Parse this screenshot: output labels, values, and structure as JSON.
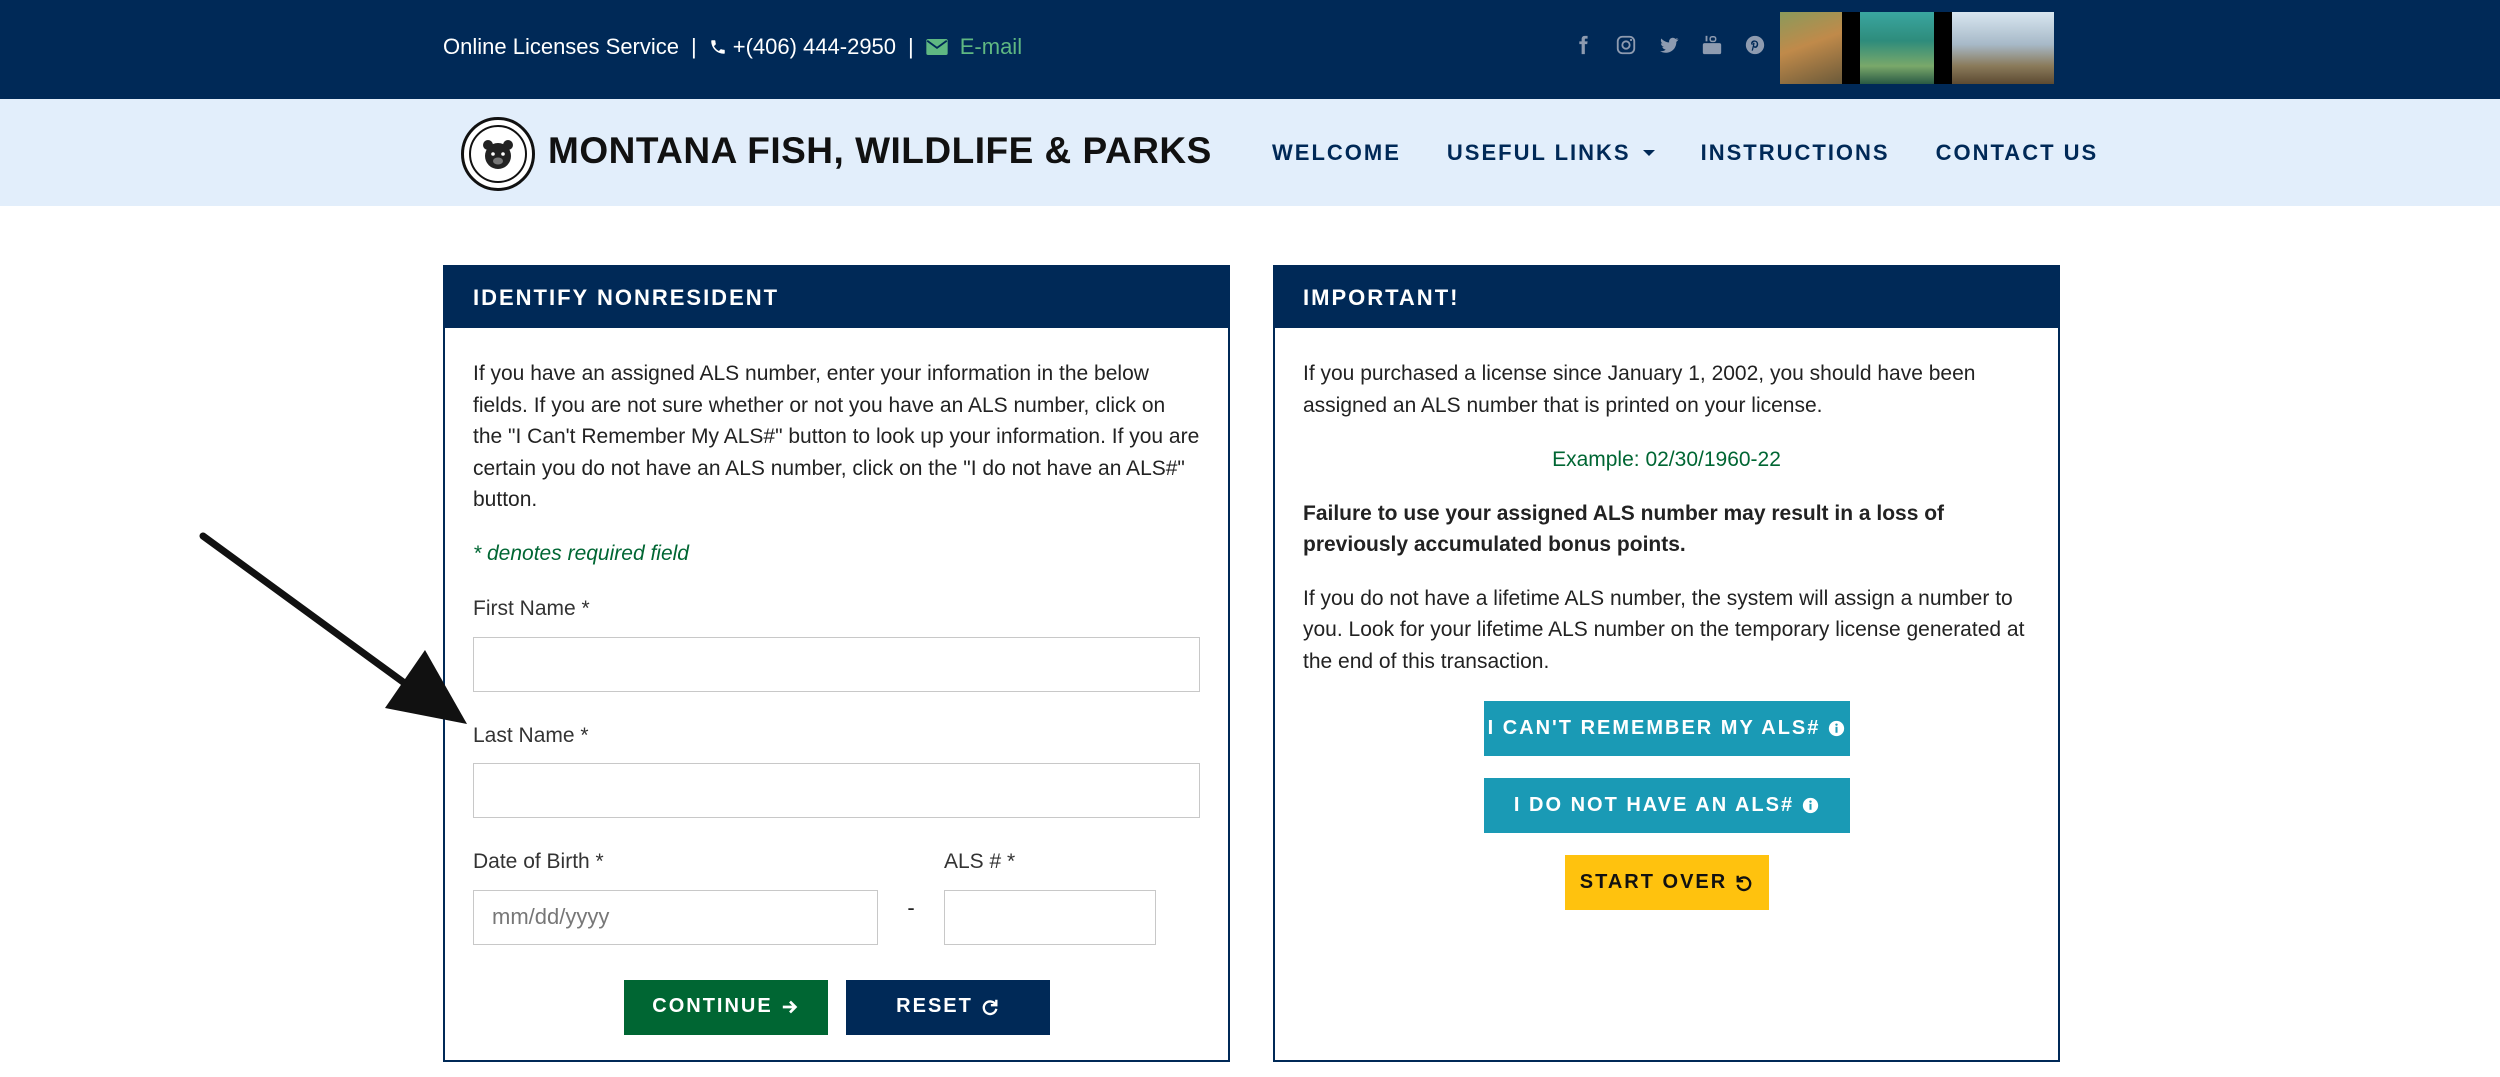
{
  "topbar": {
    "service": "Online Licenses Service",
    "separator": "|",
    "phone": "+(406) 444-2950",
    "email": "E-mail",
    "social_icons": [
      "facebook-icon",
      "instagram-icon",
      "twitter-icon",
      "youtube-icon",
      "pinterest-icon"
    ]
  },
  "navbar": {
    "brand": "MONTANA FISH, WILDLIFE & PARKS",
    "items": [
      {
        "label": "WELCOME"
      },
      {
        "label": "USEFUL LINKS"
      },
      {
        "label": "INSTRUCTIONS"
      },
      {
        "label": "CONTACT US"
      }
    ]
  },
  "identify": {
    "title": "IDENTIFY NONRESIDENT",
    "intro": "If you have an assigned ALS number, enter your information in the below fields. If you are not sure whether or not you have an ALS number, click on the \"I Can't Remember My ALS#\" button to look up your information. If you are certain you do not have an ALS number, click on the \"I do not have an ALS#\" button.",
    "required_note": "* denotes required field",
    "first_name_label": "First Name *",
    "first_name_value": "",
    "last_name_label": "Last Name *",
    "last_name_value": "",
    "dob_label": "Date of Birth *",
    "dob_placeholder": "mm/dd/yyyy",
    "dash": "-",
    "als_label": "ALS # *",
    "als_value": "",
    "continue_label": "CONTINUE",
    "reset_label": "RESET"
  },
  "important": {
    "title": "IMPORTANT!",
    "p1": "If you purchased a license since January 1, 2002, you should have been assigned an ALS number that is printed on your license.",
    "example": "Example: 02/30/1960-22",
    "warning": "Failure to use your assigned ALS number may result in a loss of previously accumulated bonus points.",
    "p2": "If you do not have a lifetime ALS number, the system will assign a number to you. Look for your lifetime ALS number on the temporary license generated at the end of this transaction.",
    "cant_remember_label": "I CAN'T REMEMBER MY ALS#",
    "no_als_label": "I DO NOT HAVE AN ALS#",
    "start_over_label": "START OVER"
  },
  "colors": {
    "navy": "#002957",
    "green": "#006633",
    "teal": "#1a9ab5",
    "yellow": "#ffc20e",
    "nav_bg": "#e2eefb"
  }
}
